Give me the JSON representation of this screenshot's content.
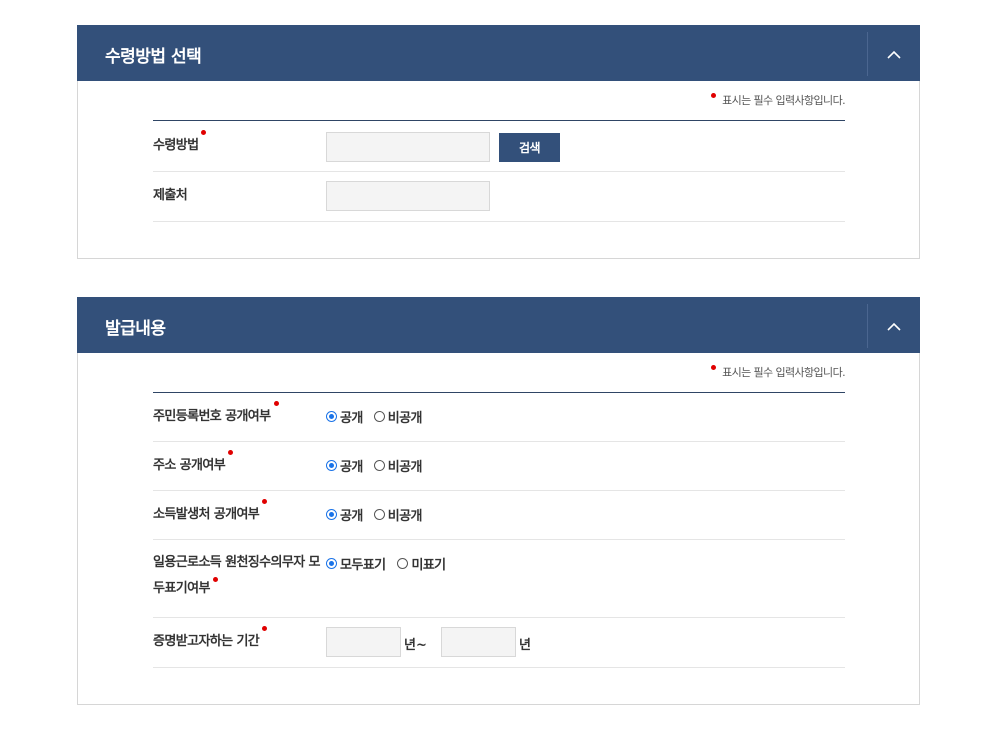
{
  "section1": {
    "title": "수령방법 선택",
    "required_note": "표시는 필수 입력사항입니다.",
    "fields": {
      "method": {
        "label": "수령방법",
        "value": "",
        "search_label": "검색"
      },
      "submit_to": {
        "label": "제출처",
        "value": ""
      }
    }
  },
  "section2": {
    "title": "발급내용",
    "required_note": "표시는 필수 입력사항입니다.",
    "rows": [
      {
        "label": "주민등록번호 공개여부",
        "options": [
          "공개",
          "비공개"
        ],
        "selected": 0
      },
      {
        "label": "주소 공개여부",
        "options": [
          "공개",
          "비공개"
        ],
        "selected": 0
      },
      {
        "label": "소득발생처 공개여부",
        "options": [
          "공개",
          "비공개"
        ],
        "selected": 0
      },
      {
        "label_line1": "일용근로소득 원천징수의무자 모",
        "label_line2": "두표기여부",
        "options": [
          "모두표기",
          "미표기"
        ],
        "selected": 0
      }
    ],
    "period": {
      "label": "증명받고자하는 기간",
      "from_year": "",
      "from_suffix": "년~",
      "to_year": "",
      "to_suffix": "년"
    }
  },
  "colors": {
    "header": "#33507a",
    "required": "#e00000",
    "radio": "#1a73e8"
  },
  "icons": {
    "collapse": "chevron-up-icon"
  }
}
